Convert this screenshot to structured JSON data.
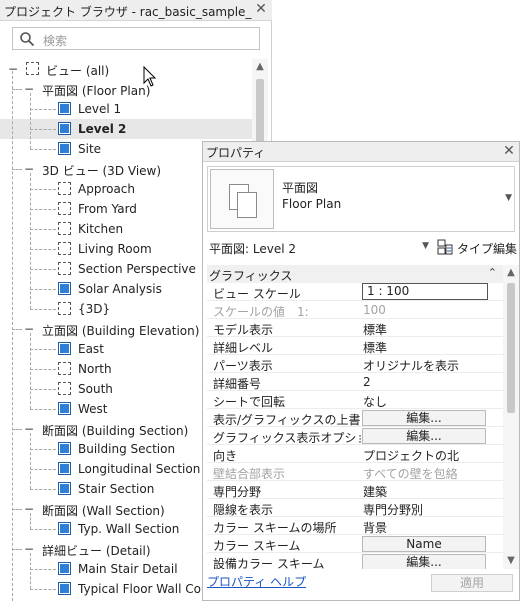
{
  "project_browser": {
    "title": "プロジェクト ブラウザ - rac_basic_sample_project.rvt",
    "search_placeholder": "検索",
    "tree": [
      {
        "label": "ビュー (all)",
        "level": 0,
        "expander": "−",
        "icon": "views-root-icon"
      },
      {
        "label": "平面図 (Floor Plan)",
        "level": 1,
        "expander": "−"
      },
      {
        "label": "Level 1",
        "level": 2,
        "icon": "view-filled-icon"
      },
      {
        "label": "Level 2",
        "level": 2,
        "icon": "view-filled-icon",
        "selected": true
      },
      {
        "label": "Site",
        "level": 2,
        "icon": "view-filled-icon"
      },
      {
        "label": "3D ビュー (3D View)",
        "level": 1,
        "expander": "−"
      },
      {
        "label": "Approach",
        "level": 2,
        "icon": "view-empty-icon"
      },
      {
        "label": "From Yard",
        "level": 2,
        "icon": "view-empty-icon"
      },
      {
        "label": "Kitchen",
        "level": 2,
        "icon": "view-empty-icon"
      },
      {
        "label": "Living Room",
        "level": 2,
        "icon": "view-empty-icon"
      },
      {
        "label": "Section Perspective",
        "level": 2,
        "icon": "view-empty-icon"
      },
      {
        "label": "Solar Analysis",
        "level": 2,
        "icon": "view-filled-icon"
      },
      {
        "label": "{3D}",
        "level": 2,
        "icon": "view-empty-icon"
      },
      {
        "label": "立面図 (Building Elevation)",
        "level": 1,
        "expander": "−"
      },
      {
        "label": "East",
        "level": 2,
        "icon": "view-filled-icon"
      },
      {
        "label": "North",
        "level": 2,
        "icon": "view-empty-icon"
      },
      {
        "label": "South",
        "level": 2,
        "icon": "view-empty-icon"
      },
      {
        "label": "West",
        "level": 2,
        "icon": "view-filled-icon"
      },
      {
        "label": "断面図 (Building Section)",
        "level": 1,
        "expander": "−"
      },
      {
        "label": "Building Section",
        "level": 2,
        "icon": "view-filled-icon"
      },
      {
        "label": "Longitudinal Section",
        "level": 2,
        "icon": "view-filled-icon"
      },
      {
        "label": "Stair Section",
        "level": 2,
        "icon": "view-filled-icon"
      },
      {
        "label": "断面図 (Wall Section)",
        "level": 1,
        "expander": "−"
      },
      {
        "label": "Typ. Wall Section",
        "level": 2,
        "icon": "view-filled-icon"
      },
      {
        "label": "詳細ビュー (Detail)",
        "level": 1,
        "expander": "−"
      },
      {
        "label": "Main Stair Detail",
        "level": 2,
        "icon": "view-filled-icon"
      },
      {
        "label": "Typical Floor Wall Connection",
        "level": 2,
        "icon": "view-filled-icon"
      }
    ]
  },
  "properties": {
    "title": "プロパティ",
    "type_name_jp": "平面図",
    "type_name_en": "Floor Plan",
    "instance_selector": "平面図: Level 2",
    "edit_type_label": "タイプ編集",
    "group_label": "グラフィックス",
    "rows": [
      {
        "key": "ビュー スケール",
        "value": "1 : 100",
        "kind": "input"
      },
      {
        "key": "スケールの値　1:",
        "value": "100",
        "kind": "disabled"
      },
      {
        "key": "モデル表示",
        "value": "標準",
        "kind": "text"
      },
      {
        "key": "詳細レベル",
        "value": "標準",
        "kind": "text"
      },
      {
        "key": "パーツ表示",
        "value": "オリジナルを表示",
        "kind": "text"
      },
      {
        "key": "詳細番号",
        "value": "2",
        "kind": "text"
      },
      {
        "key": "シートで回転",
        "value": "なし",
        "kind": "text"
      },
      {
        "key": "表示/グラフィックスの上書き",
        "value": "編集...",
        "kind": "button"
      },
      {
        "key": "グラフィックス表示オプション",
        "value": "編集...",
        "kind": "button"
      },
      {
        "key": "向き",
        "value": "プロジェクトの北",
        "kind": "text"
      },
      {
        "key": "壁結合部表示",
        "value": "すべての壁を包絡",
        "kind": "disabled"
      },
      {
        "key": "専門分野",
        "value": "建築",
        "kind": "text"
      },
      {
        "key": "隠線を表示",
        "value": "専門分野別",
        "kind": "text"
      },
      {
        "key": "カラー スキームの場所",
        "value": "背景",
        "kind": "text"
      },
      {
        "key": "カラー スキーム",
        "value": "Name",
        "kind": "button"
      },
      {
        "key": "設備カラー スキーム",
        "value": "編集...",
        "kind": "button"
      }
    ],
    "help_link": "プロパティ ヘルプ",
    "apply_label": "適用"
  }
}
